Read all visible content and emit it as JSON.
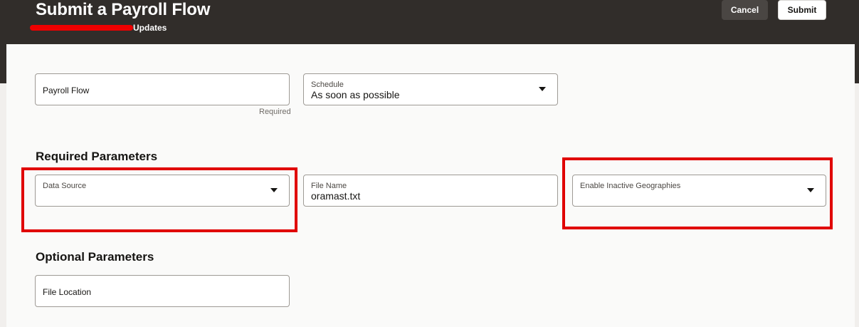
{
  "header": {
    "title": "Submit a Payroll Flow",
    "subtitle": "Updates",
    "cancel_label": "Cancel",
    "submit_label": "Submit"
  },
  "form": {
    "payroll_flow": {
      "label": "Payroll Flow",
      "helper": "Required"
    },
    "schedule": {
      "label": "Schedule",
      "value": "As soon as possible"
    }
  },
  "required_parameters": {
    "title": "Required Parameters",
    "data_source": {
      "label": "Data Source",
      "value": ""
    },
    "file_name": {
      "label": "File Name",
      "value": "oramast.txt"
    },
    "enable_inactive_geographies": {
      "label": "Enable Inactive Geographies",
      "value": ""
    }
  },
  "optional_parameters": {
    "title": "Optional Parameters",
    "file_location": {
      "label": "File Location"
    }
  },
  "colors": {
    "header_background": "#312d2a",
    "highlight_border": "#e00000",
    "redaction": "#ee0000"
  }
}
